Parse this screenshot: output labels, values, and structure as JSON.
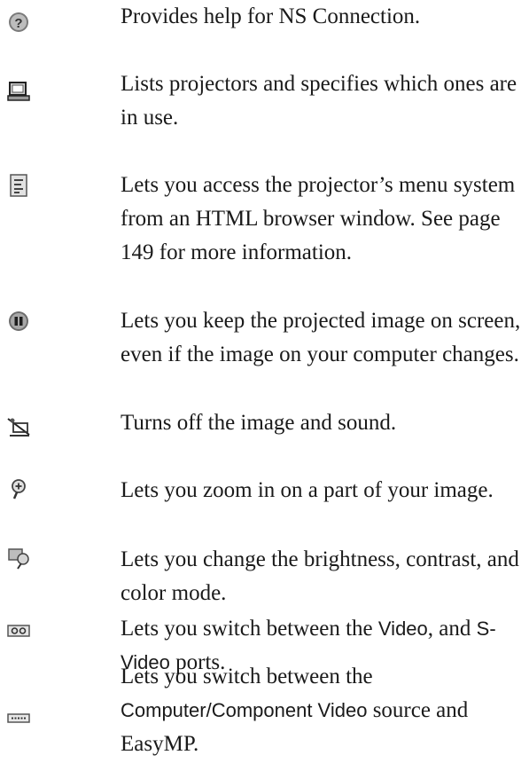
{
  "items": [
    {
      "icon": "help-icon",
      "text": "Provides help for NS Connection."
    },
    {
      "icon": "projector-list-icon",
      "text": "Lists projectors and specifies which ones are in use."
    },
    {
      "icon": "web-menu-icon",
      "text": "Lets you access the projector’s menu system from an HTML browser window. See page 149 for more information."
    },
    {
      "icon": "freeze-icon",
      "text": "Lets you keep the projected image on screen, even if the image on your computer changes."
    },
    {
      "icon": "av-mute-icon",
      "text": "Turns off the image and sound."
    },
    {
      "icon": "zoom-icon",
      "text": "Lets you zoom in on a part of your image."
    },
    {
      "icon": "color-adjust-icon",
      "text": "Lets you change the brightness, contrast, and color mode."
    },
    {
      "icon": "video-source-icon",
      "text_a": "Lets you switch between the ",
      "term_a": "Video",
      "text_b": ", and ",
      "term_b": "S-Video",
      "text_c": " ports."
    },
    {
      "icon": "computer-source-icon",
      "text_a": "Lets you switch between the ",
      "term_a": "Computer/Component Video",
      "text_b": " source and EasyMP."
    }
  ]
}
